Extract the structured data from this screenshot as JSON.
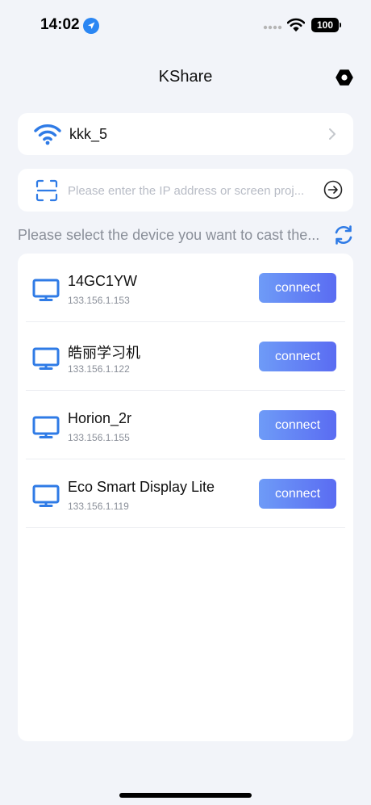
{
  "status_bar": {
    "time": "14:02",
    "battery": "100",
    "icons": [
      "location-arrow-icon",
      "signal-dots-icon",
      "wifi-icon",
      "battery-icon"
    ]
  },
  "nav": {
    "title": "KShare",
    "settings_icon": "settings-icon"
  },
  "wifi": {
    "name": "kkk_5",
    "icon": "wifi-icon"
  },
  "ip_input": {
    "placeholder": "Please enter the IP address or screen proj...",
    "value": ""
  },
  "hint": "Please select the device you want to cast the...",
  "devices": [
    {
      "name": "14GC1YW",
      "ip": "133.156.1.153",
      "button": "connect"
    },
    {
      "name": "皓丽学习机",
      "ip": "133.156.1.122",
      "button": "connect"
    },
    {
      "name": "Horion_2r",
      "ip": "133.156.1.155",
      "button": "connect"
    },
    {
      "name": "Eco Smart Display Lite",
      "ip": "133.156.1.119",
      "button": "connect"
    }
  ],
  "colors": {
    "accent": "#2f7be6",
    "background": "#f2f4f9",
    "button_start": "#6e9bf7",
    "button_end": "#5a6cf2"
  }
}
